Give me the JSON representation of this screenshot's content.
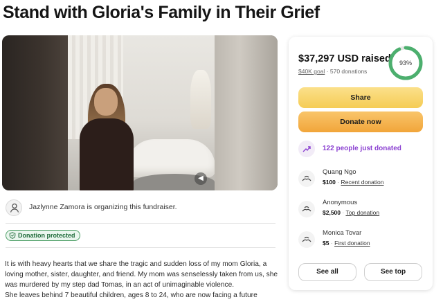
{
  "page": {
    "title": "Stand with Gloria's Family in Their Grief"
  },
  "media": {
    "image_description_icon": "photo",
    "sound_icon": "speaker-icon"
  },
  "organizer": {
    "text": "Jazlynne Zamora is organizing this fundraiser."
  },
  "badge": {
    "label": "Donation protected"
  },
  "story": {
    "lines": [
      "It is with heavy hearts that we share the tragic and sudden loss of my mom Gloria, a",
      "loving mother, sister, daughter, and friend. My mom was senselessly taken from us, she",
      "was murdered by my step dad Tomas, in an act of unimaginable violence.",
      "She leaves behind 7 beautiful children, ages 8 to 24, who are now facing a future"
    ]
  },
  "donation": {
    "raised": "$37,297 USD raised",
    "goal": "$40K goal",
    "separator": "·",
    "donations": "570 donations",
    "percent": "93%",
    "percent_value": 0.93,
    "share_label": "Share",
    "donate_label": "Donate now",
    "recent_text": "122 people just donated",
    "donors": [
      {
        "name": "Quang Ngo",
        "amount": "$100",
        "tag": "Recent donation"
      },
      {
        "name": "Anonymous",
        "amount": "$2,500",
        "tag": "Top donation"
      },
      {
        "name": "Monica Tovar",
        "amount": "$5",
        "tag": "First donation"
      }
    ],
    "see_all_label": "See all",
    "see_top_label": "See top"
  },
  "colors": {
    "accent_green": "#4caf6e",
    "share_yellow": "#f5cc55",
    "donate_orange": "#f1a53a",
    "recent_purple": "#8a3fd1"
  }
}
